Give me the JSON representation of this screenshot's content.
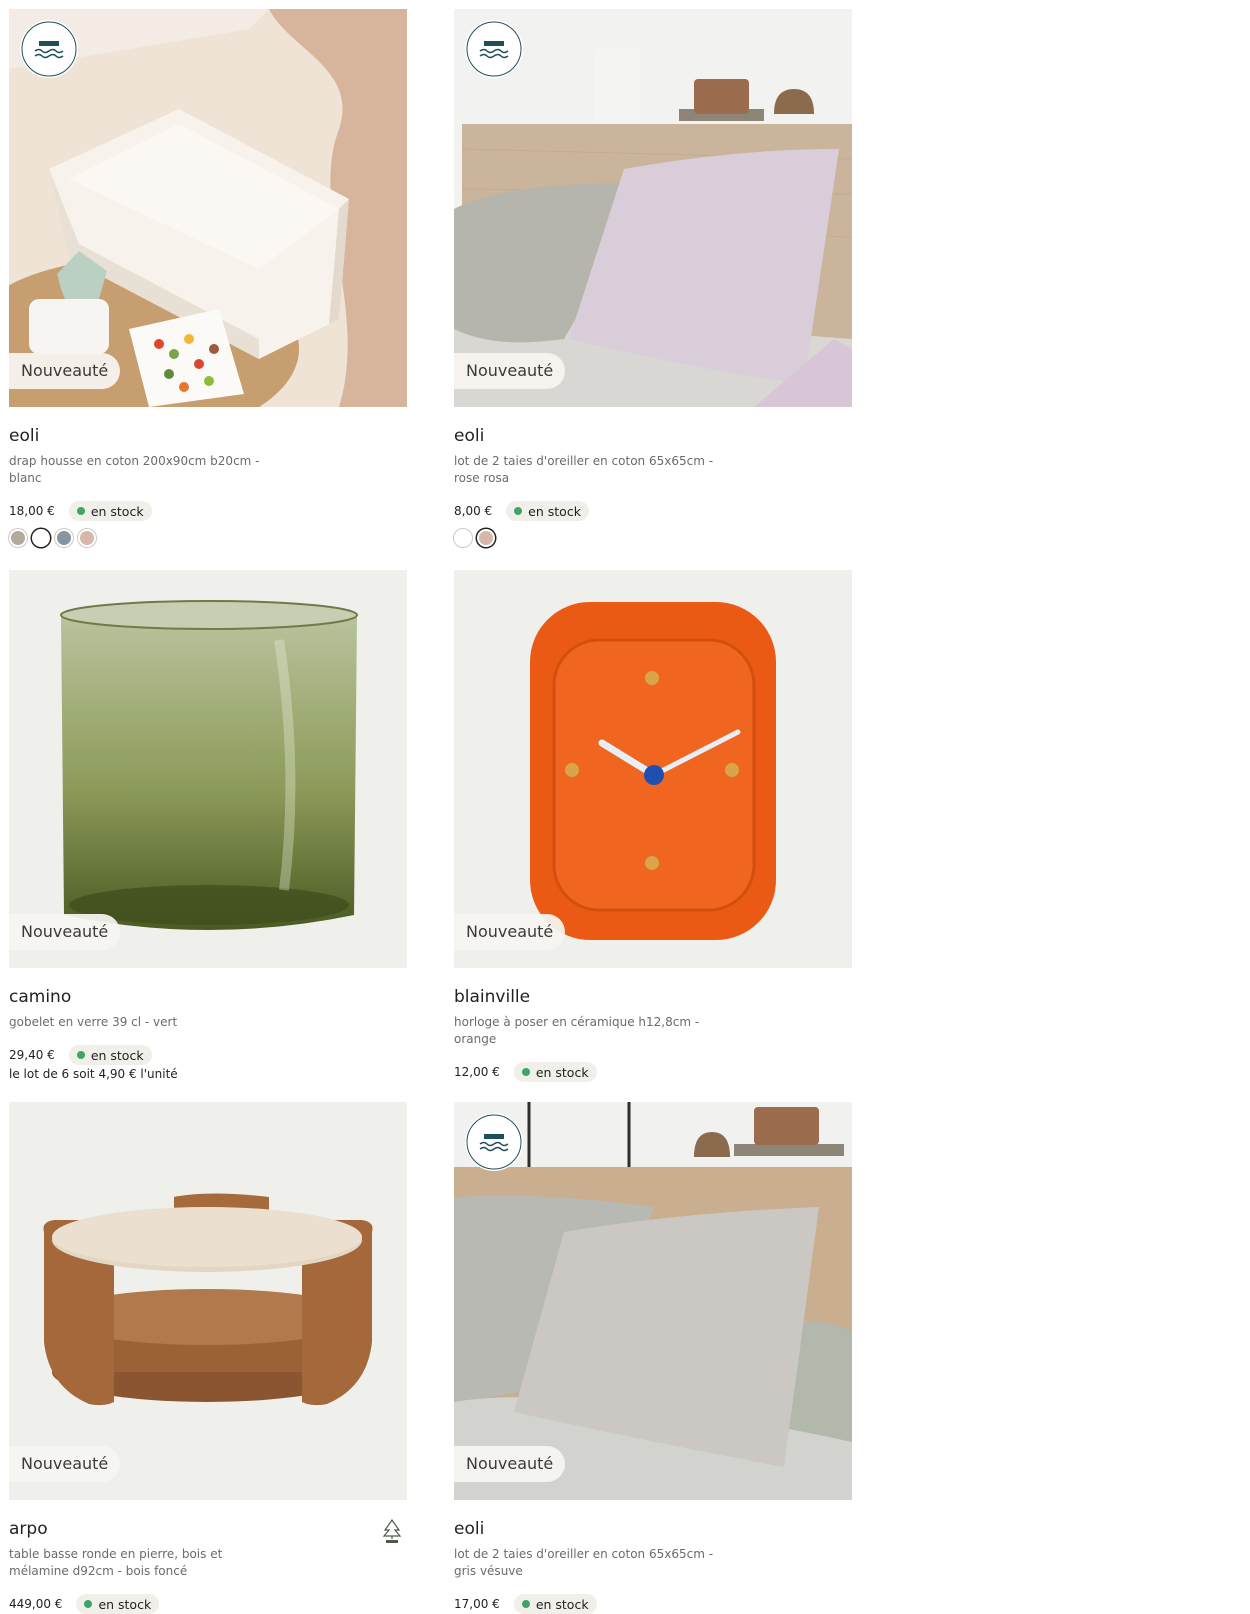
{
  "products": [
    {
      "brand": "eoli",
      "description": "drap housse en coton 200x90cm b20cm - blanc",
      "badge": "Nouveauté",
      "price": "18,00 €",
      "stock": "en stock",
      "made_in_label": "MADE IN BASSIN MÉDITERRANÉEN",
      "swatches": [
        {
          "color": "#b4ab9c",
          "selected": false
        },
        {
          "color": "#ffffff",
          "selected": true
        },
        {
          "color": "#8795a0",
          "selected": false
        },
        {
          "color": "#d9b6ac",
          "selected": false
        }
      ]
    },
    {
      "brand": "eoli",
      "description": "lot de 2 taies d'oreiller en coton 65x65cm - rose rosa",
      "badge": "Nouveauté",
      "price": "8,00 €",
      "stock": "en stock",
      "made_in_label": "MADE IN BASSIN MÉDITERRANÉEN",
      "swatches": [
        {
          "color": "#ffffff",
          "selected": false
        },
        {
          "color": "#d9b6ac",
          "selected": true
        }
      ]
    },
    {
      "brand": "camino",
      "description": "gobelet en verre 39 cl - vert",
      "badge": "Nouveauté",
      "price": "29,40 €",
      "stock": "en stock",
      "sub_price": "le lot de 6 soit 4,90 € l'unité"
    },
    {
      "brand": "blainville",
      "description": "horloge à poser en céramique h12,8cm - orange",
      "badge": "Nouveauté",
      "price": "12,00 €",
      "stock": "en stock"
    },
    {
      "brand": "arpo",
      "description": "table basse ronde en pierre, bois et mélamine d92cm - bois foncé",
      "badge": "Nouveauté",
      "price": "449,00 €",
      "stock": "en stock",
      "certification_icon": "fsc-tree-icon"
    },
    {
      "brand": "eoli",
      "description": "lot de 2 taies d'oreiller en coton 65x65cm - gris vésuve",
      "badge": "Nouveauté",
      "price": "17,00 €",
      "stock": "en stock",
      "made_in_label": "MADE IN BASSIN MÉDITERRANÉEN"
    }
  ],
  "colors": {
    "stock_green": "#3fa564",
    "stock_bg": "#f0efe9",
    "badge_bg": "#f7f5f1"
  }
}
